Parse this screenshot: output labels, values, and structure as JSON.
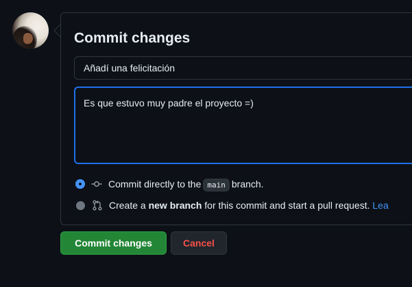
{
  "avatar": {
    "alt": "user avatar"
  },
  "form": {
    "title": "Commit changes",
    "summary_value": "Añadí una felicitación",
    "description_value": "Es que estuvo muy padre el proyecto =)"
  },
  "options": {
    "direct": {
      "selected": true,
      "prefix": "Commit directly to the",
      "branch": "main",
      "suffix": "branch."
    },
    "new_branch": {
      "selected": false,
      "prefix": "Create a",
      "bold": "new branch",
      "suffix": "for this commit and start a pull request.",
      "link": "Lea"
    }
  },
  "buttons": {
    "commit_label": "Commit changes",
    "cancel_label": "Cancel"
  },
  "colors": {
    "accent": "#4493f8",
    "commit_green": "#238636",
    "cancel_red": "#f85149",
    "border": "#30363d"
  }
}
